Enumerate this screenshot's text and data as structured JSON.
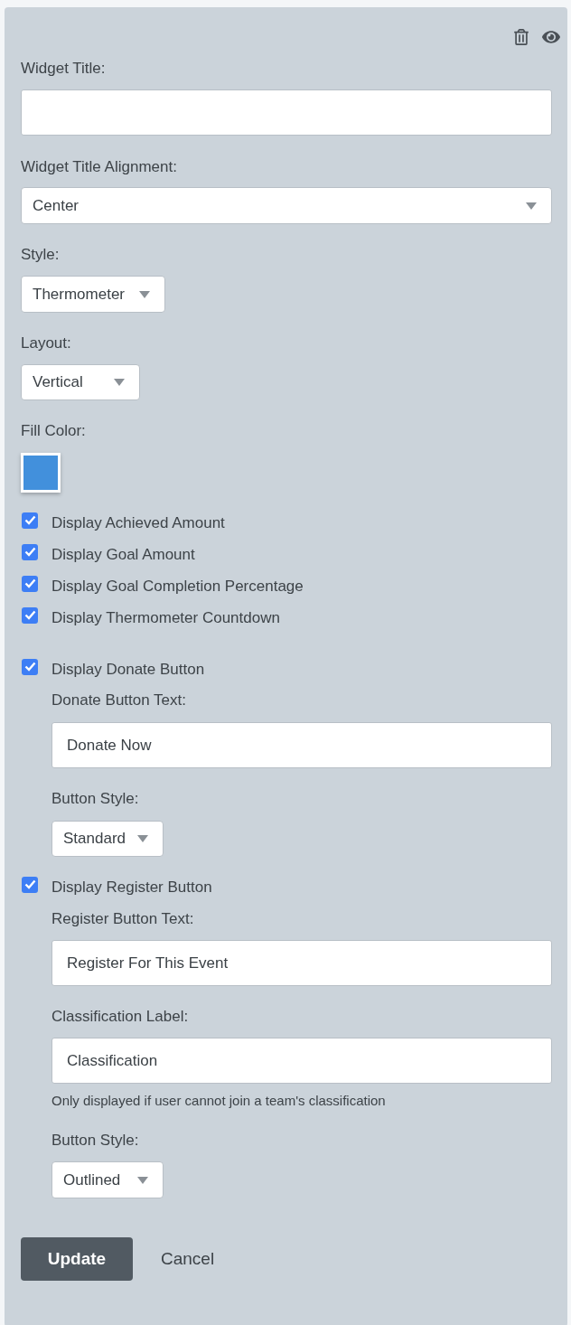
{
  "widget_title": {
    "label": "Widget Title:"
  },
  "title_alignment": {
    "label": "Widget Title Alignment:",
    "value": "Center"
  },
  "style": {
    "label": "Style:",
    "value": "Thermometer"
  },
  "layout": {
    "label": "Layout:",
    "value": "Vertical"
  },
  "fill_color": {
    "label": "Fill Color:",
    "color": "#4290dc"
  },
  "display_options": [
    {
      "label": "Display Achieved Amount",
      "checked": true
    },
    {
      "label": "Display Goal Amount",
      "checked": true
    },
    {
      "label": "Display Goal Completion Percentage",
      "checked": true
    },
    {
      "label": "Display Thermometer Countdown",
      "checked": true
    }
  ],
  "donate": {
    "label": "Display Donate Button",
    "checked": true,
    "text_field": {
      "label": "Donate Button Text:",
      "value": "Donate Now"
    },
    "button_style": {
      "label": "Button Style:",
      "value": "Standard"
    }
  },
  "register": {
    "label": "Display Register Button",
    "checked": true,
    "text_field": {
      "label": "Register Button Text:",
      "value": "Register For This Event"
    },
    "classification_field": {
      "label": "Classification Label:",
      "value": "Classification",
      "help": "Only displayed if user cannot join a team's classification"
    },
    "button_style": {
      "label": "Button Style:",
      "value": "Outlined"
    }
  },
  "actions": {
    "update": "Update",
    "cancel": "Cancel"
  }
}
